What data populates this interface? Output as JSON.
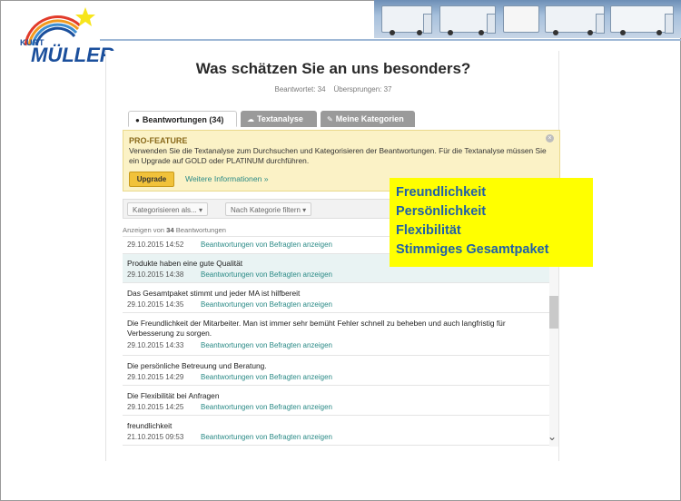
{
  "brand": {
    "logo_small": "KURT",
    "logo_main": "MÜLLER"
  },
  "survey": {
    "question": "Was schätzen Sie an uns besonders?",
    "answered_label": "Beantwortet: 34",
    "skipped_label": "Übersprungen: 37"
  },
  "tabs": [
    {
      "label": "Beantwortungen (34)",
      "icon": "speech-bubble-icon",
      "active": true
    },
    {
      "label": "Textanalyse",
      "icon": "cloud-icon",
      "active": false
    },
    {
      "label": "Meine Kategorien",
      "icon": "tag-icon",
      "active": false
    }
  ],
  "pro_feature": {
    "title": "PRO-FEATURE",
    "text": "Verwenden Sie die Textanalyse zum Durchsuchen und Kategorisieren der Beantwortungen. Für die Textanalyse müssen Sie ein Upgrade auf GOLD oder PLATINUM durchführen.",
    "upgrade_label": "Upgrade",
    "more_info_label": "Weitere Informationen »",
    "close_icon": "close-icon"
  },
  "filters": {
    "categorize_label": "Kategorisieren als...",
    "filter_label": "Nach Kategorie filtern",
    "caret": "▾"
  },
  "count": {
    "prefix": "Anzeigen von ",
    "number": "34",
    "suffix": " Beantwortungen"
  },
  "link_label": "Beantwortungen von Befragten anzeigen",
  "responses": [
    {
      "text": "",
      "date": "29.10.2015 14:52",
      "highlight": false
    },
    {
      "text": "Produkte haben eine gute Qualität",
      "date": "29.10.2015 14:38",
      "highlight": true
    },
    {
      "text": "Das Gesamtpaket stimmt und jeder MA ist hilfbereit",
      "date": "29.10.2015 14:35",
      "highlight": false
    },
    {
      "text": "Die Freundlichkeit der Mitarbeiter. Man ist immer sehr bemüht Fehler schnell zu beheben und auch langfristig für Verbesserung zu sorgen.",
      "date": "29.10.2015 14:33",
      "highlight": false
    },
    {
      "text": "Die persönliche Betreuung und Beratung.",
      "date": "29.10.2015 14:29",
      "highlight": false
    },
    {
      "text": "Die Flexibilität bei Anfragen",
      "date": "29.10.2015 14:25",
      "highlight": false
    },
    {
      "text": "freundlichkeit",
      "date": "21.10.2015 09:53",
      "highlight": false
    }
  ],
  "callout": {
    "lines": [
      "Freundlichkeit",
      "Persönlichkeit",
      "Flexibilität",
      "Stimmiges Gesamtpaket"
    ]
  },
  "colors": {
    "brand_blue": "#1b4f9c",
    "link_teal": "#2a8a86",
    "callout_yellow": "#ffff00",
    "callout_text": "#1f5fa8",
    "pro_bg": "#fbf2c6",
    "upgrade_btn": "#f1c23a"
  }
}
